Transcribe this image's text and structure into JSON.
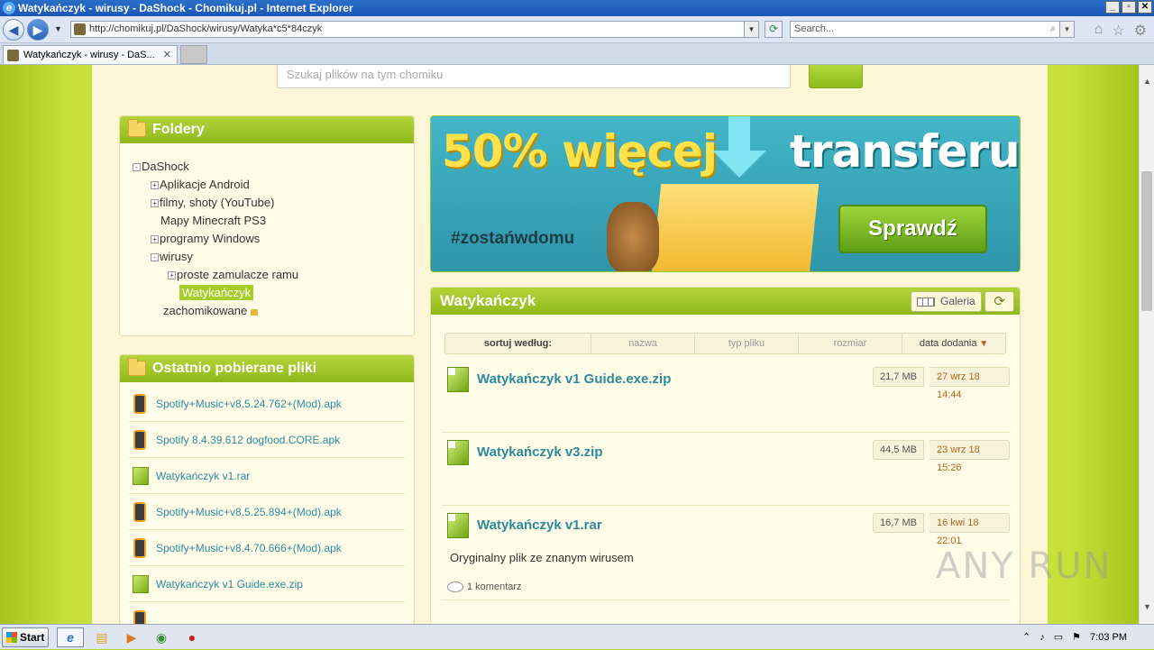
{
  "window": {
    "title": "Watykańczyk - wirusy - DaShock - Chomikuj.pl - Internet Explorer"
  },
  "browser": {
    "url": "http://chomikuj.pl/DaShock/wirusy/Watyka*c5*84czyk",
    "search_placeholder": "Search...",
    "tab_label": "Watykańczyk - wirusy - DaS..."
  },
  "page": {
    "search_placeholder": "Szukaj plików na tym chomiku",
    "folders": {
      "title": "Foldery",
      "root": "DaShock",
      "items": [
        {
          "label": "Aplikacje Android",
          "expand": "+"
        },
        {
          "label": "filmy, shoty (YouTube)",
          "expand": "+"
        },
        {
          "label": "Mapy Minecraft PS3",
          "expand": ""
        },
        {
          "label": "programy Windows",
          "expand": "+"
        },
        {
          "label": "wirusy",
          "expand": "-"
        },
        {
          "label": "proste zamulacze ramu",
          "expand": "+"
        },
        {
          "label": "Watykańczyk",
          "expand": ""
        },
        {
          "label": "zachomikowane",
          "expand": ""
        }
      ]
    },
    "recent": {
      "title": "Ostatnio pobierane pliki",
      "items": [
        {
          "label": "Spotify+Music+v8.5.24.762+(Mod).apk",
          "icon": "phone-icon"
        },
        {
          "label": "Spotify 8.4.39.612 dogfood.CORE.apk",
          "icon": "phone-icon"
        },
        {
          "label": "Watykańczyk v1.rar",
          "icon": "rar-icon"
        },
        {
          "label": "Spotify+Music+v8.5.25.894+(Mod).apk",
          "icon": "phone-icon"
        },
        {
          "label": "Spotify+Music+v8.4.70.666+(Mod).apk",
          "icon": "phone-icon"
        },
        {
          "label": "Watykańczyk v1 Guide.exe.zip",
          "icon": "rar-icon"
        }
      ]
    },
    "banner": {
      "left_text": "50% więcej",
      "right_text": "transferu!",
      "hashtag": "#zostańwdomu",
      "button": "Sprawdź"
    },
    "main": {
      "title": "Watykańczyk",
      "gallery_label": "Galeria",
      "sort": {
        "label": "sortuj według:",
        "options": [
          "nazwa",
          "typ pliku",
          "rozmiar",
          "data dodania"
        ]
      },
      "files": [
        {
          "name": "Watykańczyk v1 Guide.exe.zip",
          "size": "21,7 MB",
          "date": "27 wrz 18 14:44",
          "desc": "",
          "comments": ""
        },
        {
          "name": "Watykańczyk v3.zip",
          "size": "44,5 MB",
          "date": "23 wrz 18 15:26",
          "desc": "",
          "comments": ""
        },
        {
          "name": "Watykańczyk v1.rar",
          "size": "16,7 MB",
          "date": "16 kwi 18 22:01",
          "desc": "Oryginalny plik ze znanym wirusem",
          "comments": "1 komentarz"
        }
      ]
    }
  },
  "watermark": "ANY RUN",
  "taskbar": {
    "start_label": "Start",
    "clock": "7:03 PM"
  }
}
